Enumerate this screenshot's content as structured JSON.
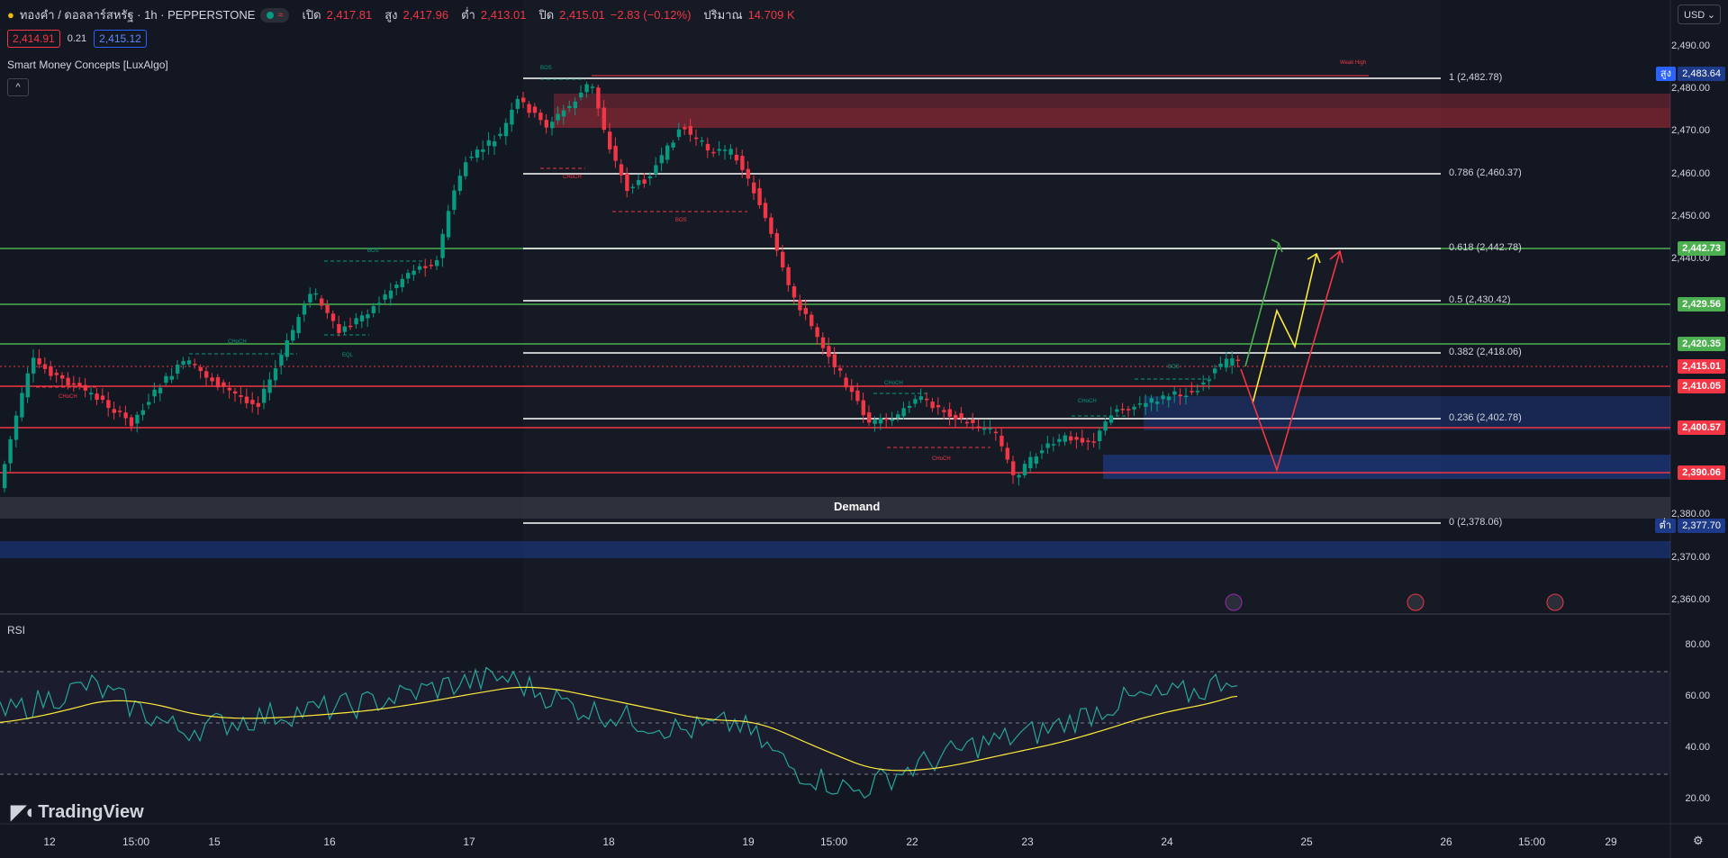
{
  "header": {
    "symbol": "ทองคำ / ดอลลาร์สหรัฐ · 1h · PEPPERSTONE",
    "open_label": "เปิด",
    "open": "2,417.81",
    "high_label": "สูง",
    "high": "2,417.96",
    "low_label": "ต่ำ",
    "low": "2,413.01",
    "close_label": "ปิด",
    "close": "2,415.01",
    "change": "−2.83 (−0.12%)",
    "volume_label": "ปริมาณ",
    "volume": "14.709 K"
  },
  "quote": {
    "bid": "2,414.91",
    "spread": "0.21",
    "ask": "2,415.12"
  },
  "indicators": {
    "smc": "Smart Money Concepts [LuxAlgo]",
    "rsi": "RSI",
    "collapse": "^"
  },
  "currency": "USD",
  "colors": {
    "bg": "#131722",
    "up": "#089981",
    "down": "#f23645",
    "grid": "#1e222d",
    "ask": "#2962ff"
  },
  "price_axis": [
    "2,490.00",
    "2,480.00",
    "2,470.00",
    "2,460.00",
    "2,450.00",
    "2,440.00",
    "2,380.00",
    "2,370.00",
    "2,360.00"
  ],
  "price_tags": {
    "high_label": "สูง",
    "high": "2,483.64",
    "t1": "2,442.73",
    "t2": "2,429.56",
    "t3": "2,420.35",
    "t4": "2,415.01",
    "t5": "2,410.05",
    "t6": "2,400.57",
    "t7": "2,390.06",
    "low_label": "ต่ำ",
    "low": "2,377.70"
  },
  "fib_levels": [
    "1 (2,482.78)",
    "0.786 (2,460.37)",
    "0.618 (2,442.78)",
    "0.5 (2,430.42)",
    "0.382 (2,418.06)",
    "0.236 (2,402.78)",
    "0 (2,378.06)"
  ],
  "zones": {
    "demand": "Demand",
    "weak_high": "Weak High"
  },
  "smc_labels": {
    "bos": "BOS",
    "choch": "CHoCH",
    "eql": "EQL"
  },
  "rsi_axis": [
    "80.00",
    "60.00",
    "40.00",
    "20.00"
  ],
  "time_axis": [
    "12",
    "15:00",
    "15",
    "16",
    "17",
    "18",
    "19",
    "15:00",
    "22",
    "23",
    "24",
    "25",
    "26",
    "15:00",
    "29"
  ],
  "branding": "TradingView"
}
